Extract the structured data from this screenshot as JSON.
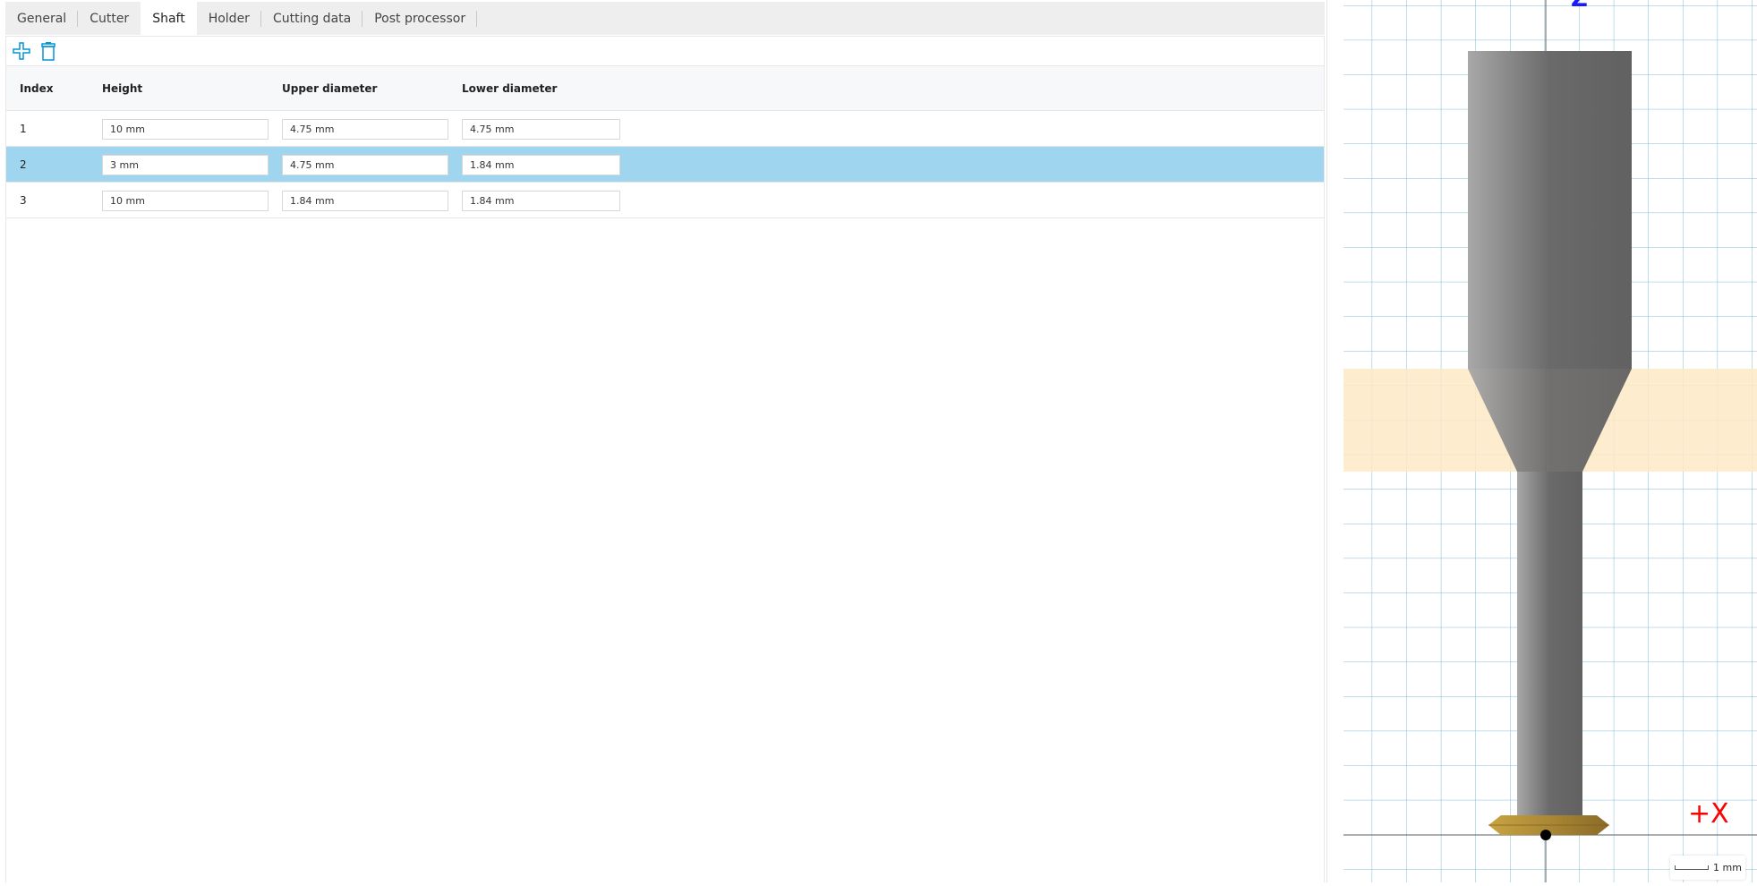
{
  "tabs": [
    {
      "label": "General"
    },
    {
      "label": "Cutter"
    },
    {
      "label": "Shaft",
      "active": true
    },
    {
      "label": "Holder"
    },
    {
      "label": "Cutting data"
    },
    {
      "label": "Post processor"
    }
  ],
  "toolbar": {
    "add_icon": "plus-icon",
    "delete_icon": "trash-icon"
  },
  "table": {
    "headers": [
      "Index",
      "Height",
      "Upper diameter",
      "Lower diameter"
    ],
    "rows": [
      {
        "index": "1",
        "height": "10 mm",
        "upper": "4.75 mm",
        "lower": "4.75 mm"
      },
      {
        "index": "2",
        "height": "3 mm",
        "upper": "4.75 mm",
        "lower": "1.84 mm",
        "selected": true
      },
      {
        "index": "3",
        "height": "10 mm",
        "upper": "1.84 mm",
        "lower": "1.84 mm"
      }
    ]
  },
  "viewer": {
    "z_axis_label": "Z",
    "x_axis_label": "+X",
    "scale_label": "1 mm",
    "highlight_color": "#fde9c4",
    "grid_color": "#7fbcd6",
    "accent": "#0096d6"
  }
}
